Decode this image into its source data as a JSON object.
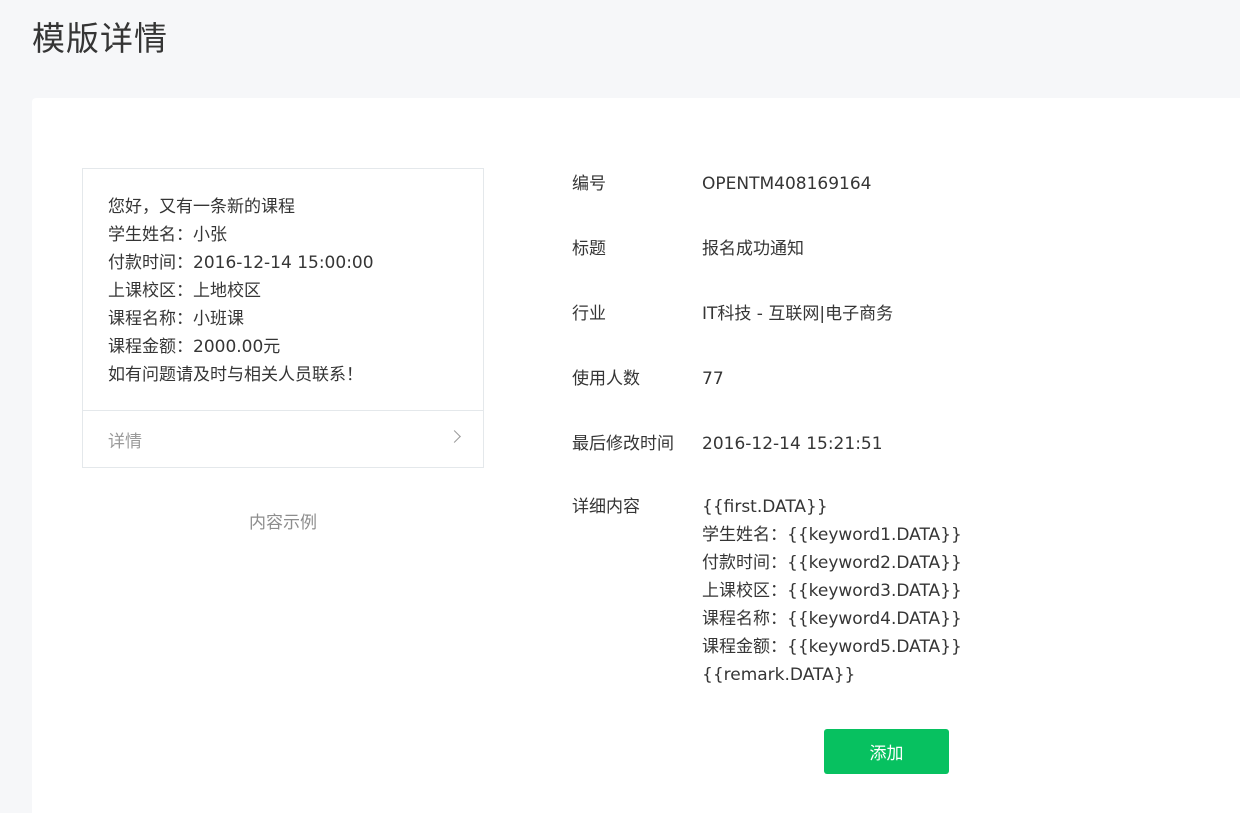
{
  "page": {
    "title": "模版详情"
  },
  "preview": {
    "lines": [
      "您好，又有一条新的课程",
      "学生姓名：小张",
      "付款时间：2016-12-14 15:00:00",
      "上课校区：上地校区",
      "课程名称：小班课",
      "课程金额：2000.00元",
      "如有问题请及时与相关人员联系！"
    ],
    "footer_label": "详情",
    "caption": "内容示例"
  },
  "info": {
    "id_label": "编号",
    "id_value": "OPENTM408169164",
    "title_label": "标题",
    "title_value": "报名成功通知",
    "industry_label": "行业",
    "industry_value": "IT科技 - 互联网|电子商务",
    "users_label": "使用人数",
    "users_value": "77",
    "modified_label": "最后修改时间",
    "modified_value": "2016-12-14 15:21:51",
    "detail_label": "详细内容",
    "detail_lines": [
      "{{first.DATA}}",
      "学生姓名：{{keyword1.DATA}}",
      "付款时间：{{keyword2.DATA}}",
      "上课校区：{{keyword3.DATA}}",
      "课程名称：{{keyword4.DATA}}",
      "课程金额：{{keyword5.DATA}}",
      "{{remark.DATA}}"
    ]
  },
  "actions": {
    "add_label": "添加"
  },
  "colors": {
    "accent": "#07c160",
    "background": "#f6f7f9",
    "panel": "#ffffff"
  }
}
